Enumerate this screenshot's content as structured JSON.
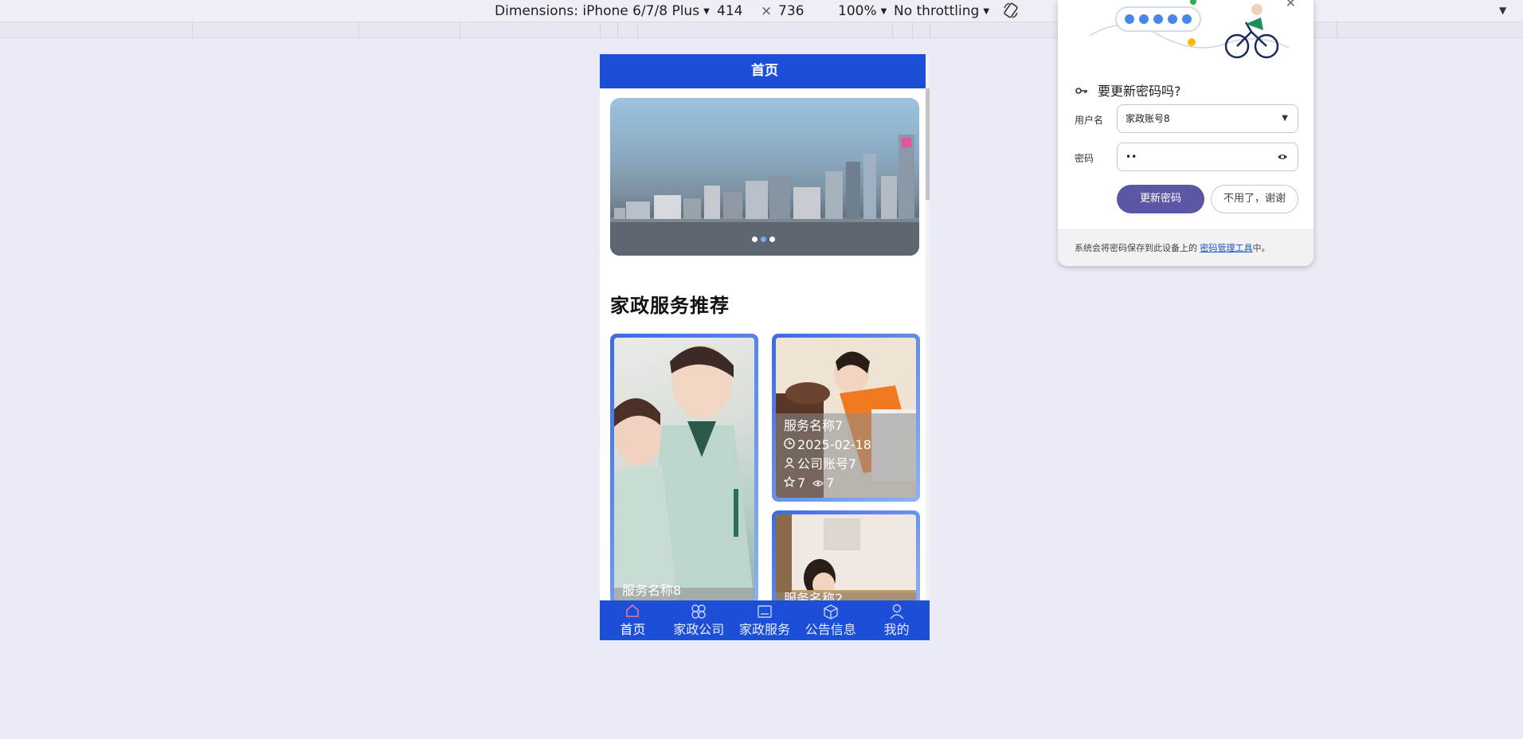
{
  "devtools": {
    "device": "Dimensions: iPhone 6/7/8 Plus",
    "width": "414",
    "times": "×",
    "height": "736",
    "zoom": "100%",
    "throttling": "No throttling",
    "rotate_icon": "rotate-icon"
  },
  "phone": {
    "header_title": "首页",
    "section_title": "家政服务推荐",
    "banner_dots": 3,
    "banner_active_dot": 2,
    "cards": [
      {
        "name": "服务名称8"
      },
      {
        "name": "服务名称7",
        "date": "2025-02-18",
        "company": "公司账号7",
        "stars": "7",
        "views": "7"
      },
      {
        "name": "服务名称2"
      }
    ],
    "tabs": [
      {
        "label": "首页",
        "icon": "home-icon"
      },
      {
        "label": "家政公司",
        "icon": "company-icon"
      },
      {
        "label": "家政服务",
        "icon": "service-icon"
      },
      {
        "label": "公告信息",
        "icon": "notice-icon"
      },
      {
        "label": "我的",
        "icon": "user-icon"
      }
    ],
    "active_tab": 0
  },
  "password_popup": {
    "title": "要更新密码吗?",
    "username_label": "用户名",
    "username_value": "家政账号8",
    "password_label": "密码",
    "password_value": "••",
    "update_button": "更新密码",
    "dismiss_button": "不用了，谢谢",
    "footer_text": "系统会将密码保存到此设备上的",
    "footer_link": "密码管理工具",
    "footer_suffix": "中。"
  },
  "colors": {
    "brand_blue": "#1d4ed8",
    "popup_primary": "#5b57a4"
  }
}
